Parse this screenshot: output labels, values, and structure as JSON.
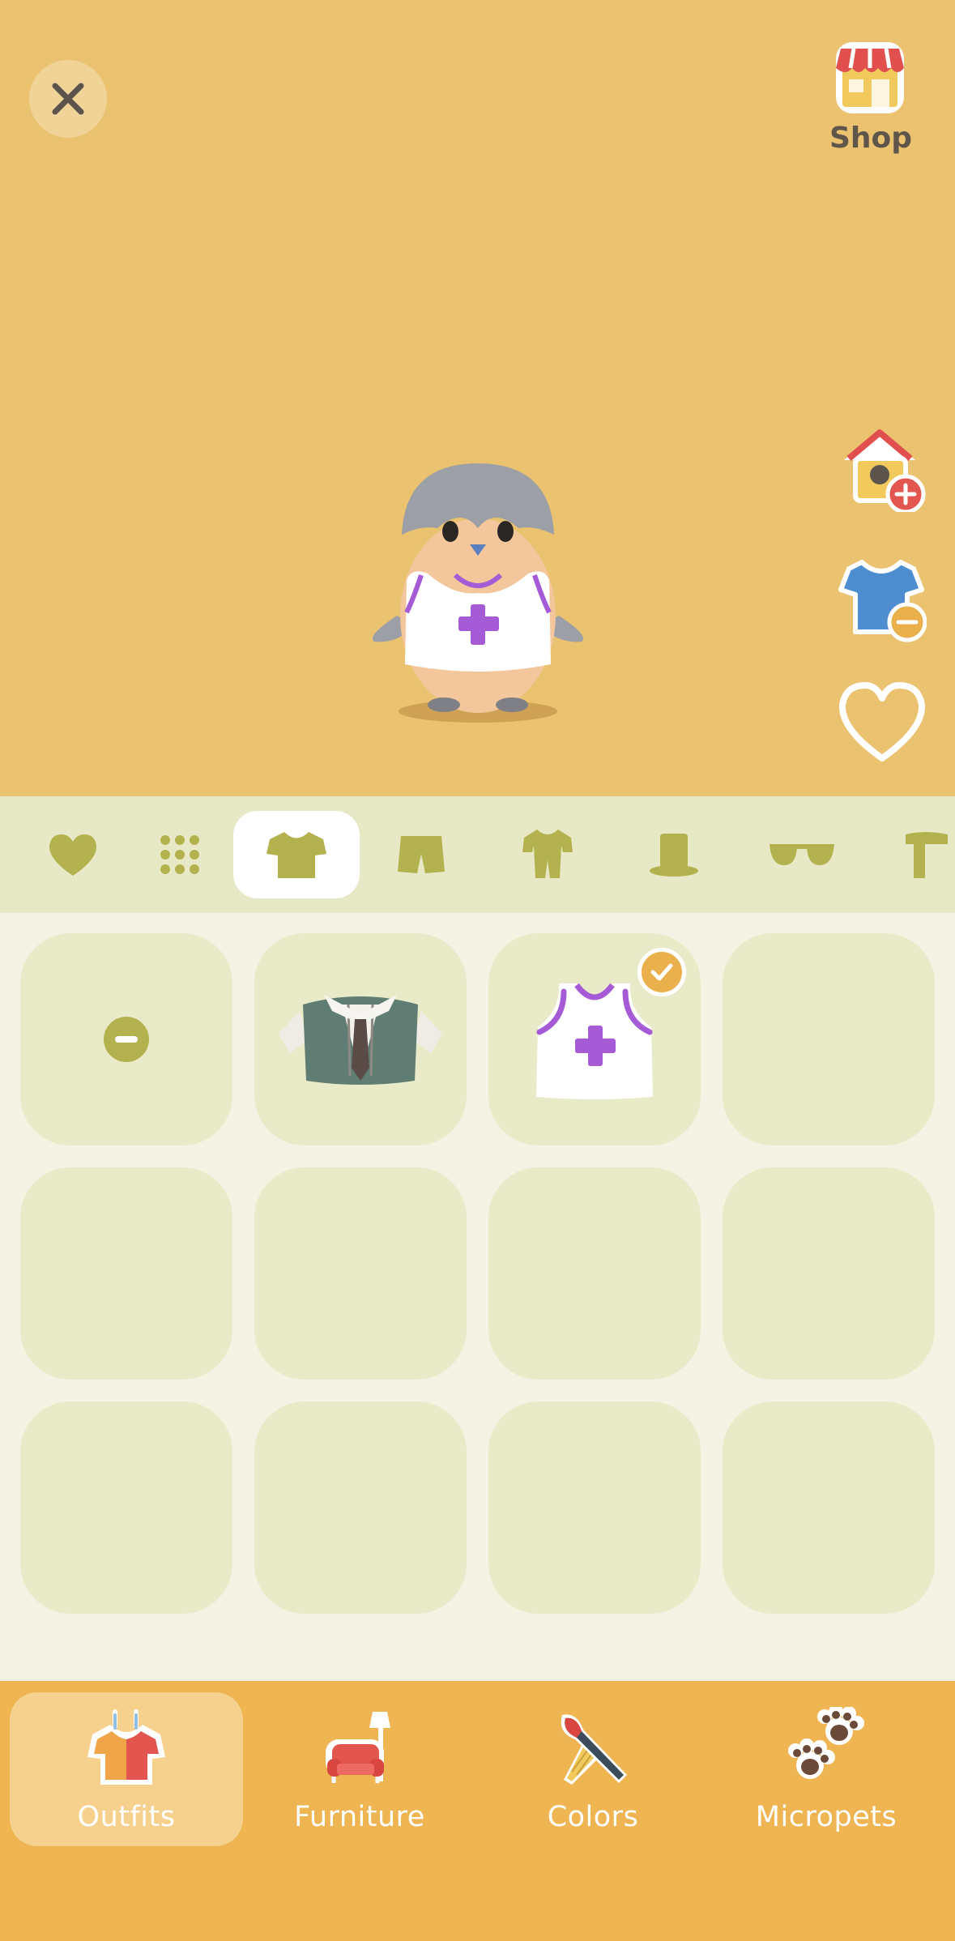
{
  "header": {
    "close_icon": "close-icon",
    "shop_label": "Shop",
    "shop_icon": "shop-icon"
  },
  "side_actions": [
    {
      "name": "birdhouse-plus",
      "icon": "birdhouse-add-icon"
    },
    {
      "name": "shirt-minus",
      "icon": "shirt-remove-icon"
    },
    {
      "name": "favorite",
      "icon": "heart-outline-icon"
    }
  ],
  "category_tabs": [
    {
      "icon": "heart-icon"
    },
    {
      "icon": "grid-dots-icon"
    },
    {
      "icon": "tshirt-icon",
      "active": true
    },
    {
      "icon": "shorts-icon"
    },
    {
      "icon": "onesie-icon"
    },
    {
      "icon": "top-hat-icon"
    },
    {
      "icon": "sunglasses-icon"
    },
    {
      "icon": "scarf-icon"
    }
  ],
  "items_grid": [
    {
      "content": "remove-item"
    },
    {
      "content": "green-vest-with-tie"
    },
    {
      "content": "white-tank-purple-cross",
      "equipped": true
    },
    {
      "content": "empty"
    },
    {
      "content": "empty"
    },
    {
      "content": "empty"
    },
    {
      "content": "empty"
    },
    {
      "content": "empty"
    },
    {
      "content": "empty"
    },
    {
      "content": "empty"
    },
    {
      "content": "empty"
    },
    {
      "content": "empty"
    }
  ],
  "bottom_nav": [
    {
      "label": "Outfits",
      "icon": "outfits-icon",
      "active": true
    },
    {
      "label": "Furniture",
      "icon": "furniture-icon"
    },
    {
      "label": "Colors",
      "icon": "paint-tools-icon"
    },
    {
      "label": "Micropets",
      "icon": "paw-prints-icon"
    }
  ],
  "colors": {
    "stage_bg": "#ebc26f",
    "accent_orange": "#eeb552",
    "olive_icon": "#b4b24f",
    "purple": "#a55ad6"
  }
}
